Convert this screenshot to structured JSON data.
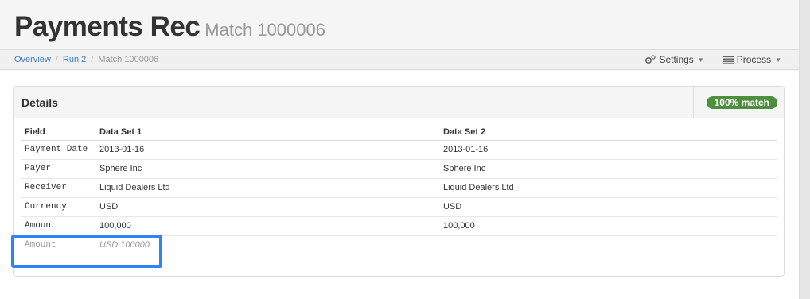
{
  "header": {
    "title": "Payments Rec",
    "subtitle": "Match 1000006"
  },
  "breadcrumb": [
    "Overview",
    "Run 2",
    "Match 1000006"
  ],
  "nav": {
    "settings": "Settings",
    "process": "Process",
    "settings_icon": "gears-icon",
    "process_icon": "list-icon"
  },
  "panel": {
    "title": "Details",
    "badge": "100% match",
    "badge_color": "#4e8f3e"
  },
  "table": {
    "headers": [
      "Field",
      "Data Set 1",
      "Data Set 2"
    ],
    "rows": [
      [
        "Payment Date",
        "2013-01-16",
        "2013-01-16"
      ],
      [
        "Payer",
        "Sphere Inc",
        "Sphere Inc"
      ],
      [
        "Receiver",
        "Liquid Dealers Ltd",
        "Liquid Dealers Ltd"
      ],
      [
        "Currency",
        "USD",
        "USD"
      ],
      [
        "Amount",
        "100,000",
        "100,000"
      ],
      [
        "Amount",
        "USD 100000",
        ""
      ]
    ]
  },
  "highlight_color": "#2e84f0"
}
